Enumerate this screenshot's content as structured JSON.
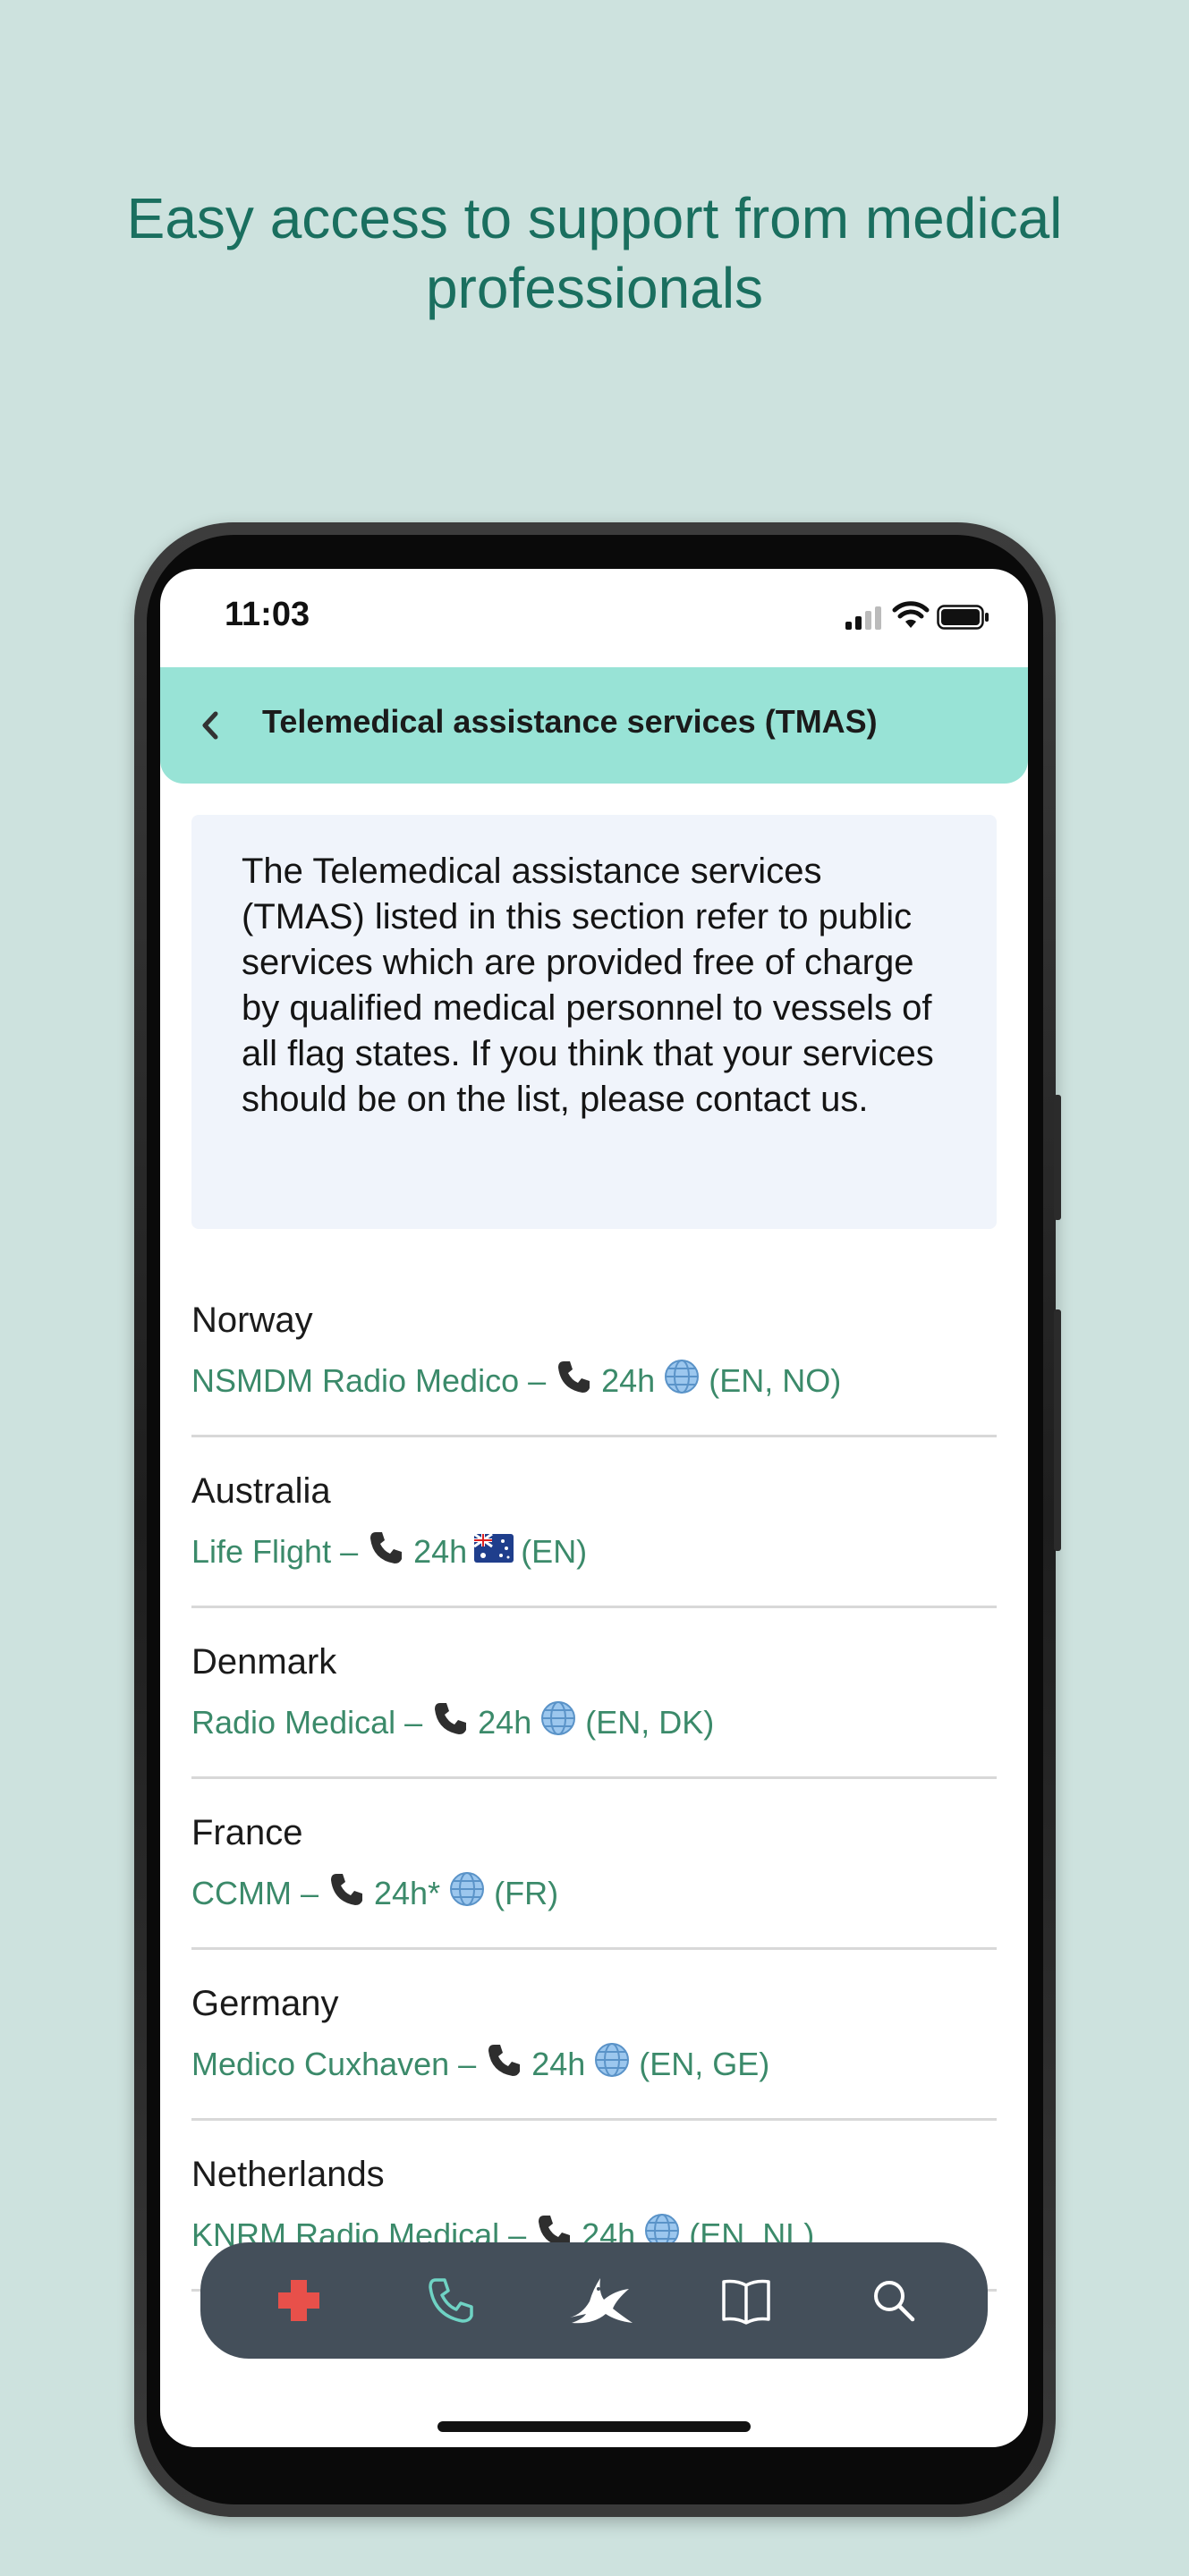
{
  "headline": "Easy access to support from medical professionals",
  "status_bar": {
    "time": "11:03"
  },
  "header": {
    "title": "Telemedical assistance services (TMAS)"
  },
  "info_text": "The Telemedical assistance services (TMAS) listed in this section refer to public services which are provided free of charge by qualified medical personnel to vessels of all flag states. If you think that your services should be on the list, please contact us.",
  "services": [
    {
      "country": "Norway",
      "name": "NSMDM Radio Medico",
      "hours": "24h",
      "lang_icon": "globe-icon",
      "languages": "(EN, NO)"
    },
    {
      "country": "Australia",
      "name": "Life Flight",
      "hours": "24h",
      "lang_icon": "australia-flag-icon",
      "languages": "(EN)"
    },
    {
      "country": "Denmark",
      "name": "Radio Medical",
      "hours": "24h",
      "lang_icon": "globe-icon",
      "languages": "(EN, DK)"
    },
    {
      "country": "France",
      "name": "CCMM",
      "hours": "24h*",
      "lang_icon": "globe-icon",
      "languages": "(FR)"
    },
    {
      "country": "Germany",
      "name": "Medico Cuxhaven",
      "hours": "24h",
      "lang_icon": "globe-icon",
      "languages": "(EN, GE)"
    },
    {
      "country": "Netherlands",
      "name": "KNRM Radio Medical",
      "hours": "24h",
      "lang_icon": "globe-icon",
      "languages": "(EN, NL)"
    }
  ],
  "separator": "–",
  "bottom_nav": [
    {
      "icon": "medical-cross-icon",
      "active": true
    },
    {
      "icon": "phone-icon",
      "active": false
    },
    {
      "icon": "swallow-icon",
      "active": false
    },
    {
      "icon": "book-icon",
      "active": false
    },
    {
      "icon": "search-icon",
      "active": false
    }
  ],
  "colors": {
    "background": "#cde2de",
    "headline": "#1a6f5f",
    "header": "#98e3d6",
    "info_box": "#f0f4fb",
    "service_text": "#3b8a6a",
    "nav_bar": "#444f5a",
    "nav_cross": "#e8504a",
    "nav_phone": "#6fd3c4"
  }
}
